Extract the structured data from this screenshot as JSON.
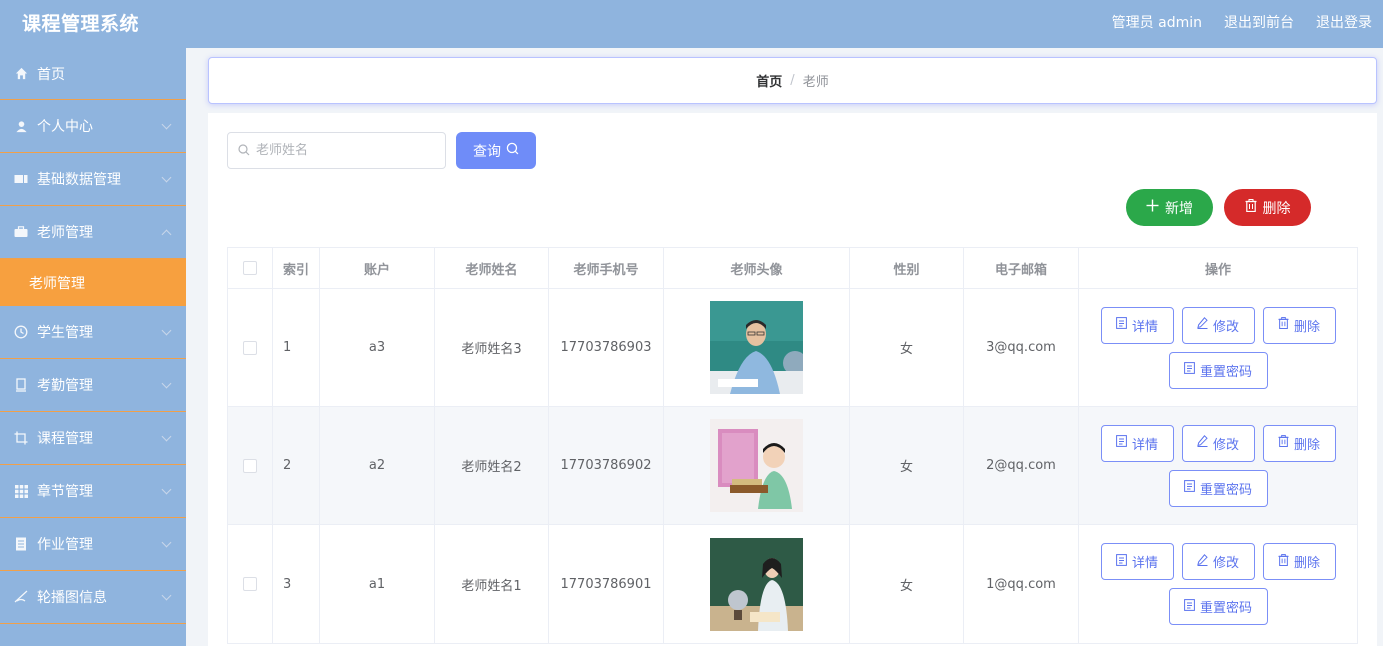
{
  "app": {
    "title": "课程管理系统"
  },
  "header_links": {
    "admin": "管理员 admin",
    "front": "退出到前台",
    "logout": "退出登录"
  },
  "sidebar": {
    "items": [
      {
        "label": "首页",
        "icon": "home-icon"
      },
      {
        "label": "个人中心",
        "icon": "user-icon"
      },
      {
        "label": "基础数据管理",
        "icon": "ticket-icon"
      },
      {
        "label": "老师管理",
        "icon": "briefcase-icon"
      },
      {
        "label": "老师管理",
        "icon": ""
      },
      {
        "label": "学生管理",
        "icon": "clock-icon"
      },
      {
        "label": "考勤管理",
        "icon": "document-icon"
      },
      {
        "label": "课程管理",
        "icon": "crop-icon"
      },
      {
        "label": "章节管理",
        "icon": "grid-icon"
      },
      {
        "label": "作业管理",
        "icon": "notebook-icon"
      },
      {
        "label": "轮播图信息",
        "icon": "no-signal-icon"
      }
    ]
  },
  "breadcrumb": {
    "home": "首页",
    "separator": "/",
    "current": "老师"
  },
  "search": {
    "placeholder": "老师姓名",
    "value": ""
  },
  "buttons": {
    "query": "查询",
    "add": "新增",
    "delete": "删除"
  },
  "table": {
    "headers": [
      "",
      "索引",
      "账户",
      "老师姓名",
      "老师手机号",
      "老师头像",
      "性别",
      "电子邮箱",
      "操作"
    ],
    "rows": [
      {
        "index": "1",
        "account": "a3",
        "name": "老师姓名3",
        "phone": "17703786903",
        "gender": "女",
        "email": "3@qq.com"
      },
      {
        "index": "2",
        "account": "a2",
        "name": "老师姓名2",
        "phone": "17703786902",
        "gender": "女",
        "email": "2@qq.com"
      },
      {
        "index": "3",
        "account": "a1",
        "name": "老师姓名1",
        "phone": "17703786901",
        "gender": "女",
        "email": "1@qq.com"
      }
    ],
    "row_actions": {
      "detail": "详情",
      "edit": "修改",
      "delete": "删除",
      "reset": "重置密码"
    }
  },
  "colors": {
    "header_bg": "#8fb4de",
    "active_menu": "#f7a03f",
    "primary": "#6f8cf8",
    "success": "#2ba84a",
    "danger": "#d52a2a"
  }
}
